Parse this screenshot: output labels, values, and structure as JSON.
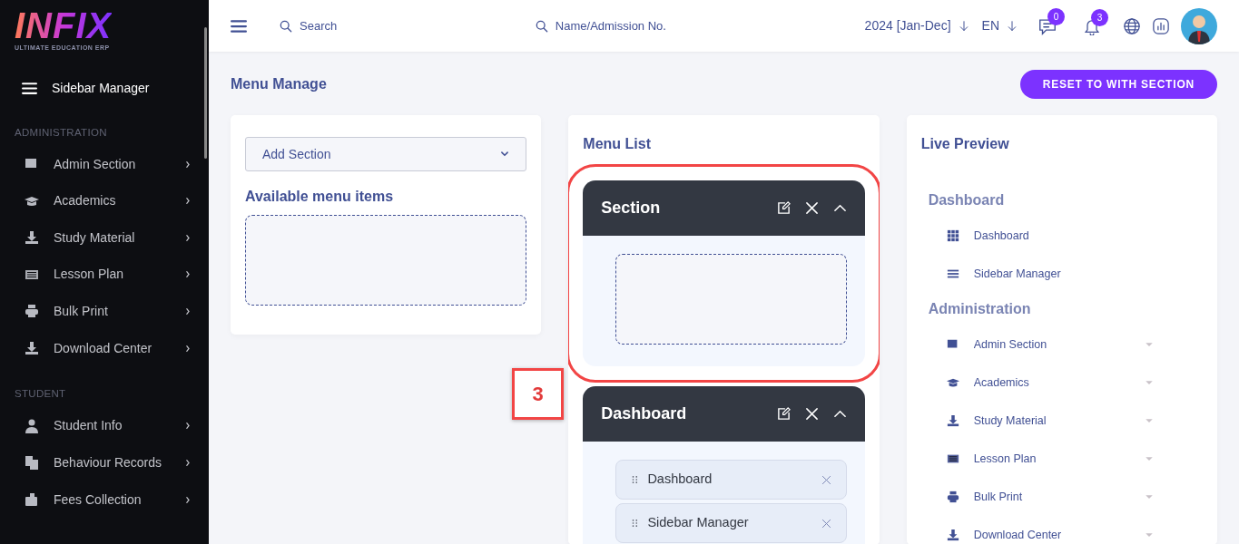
{
  "brand": {
    "logo": "INFIX",
    "tagline": "ULTIMATE EDUCATION ERP"
  },
  "sidebar": {
    "title": "Sidebar Manager",
    "groups": [
      {
        "heading": "ADMINISTRATION",
        "items": [
          {
            "label": "Admin Section"
          },
          {
            "label": "Academics"
          },
          {
            "label": "Study Material"
          },
          {
            "label": "Lesson Plan"
          },
          {
            "label": "Bulk Print"
          },
          {
            "label": "Download Center"
          }
        ]
      },
      {
        "heading": "STUDENT",
        "items": [
          {
            "label": "Student Info"
          },
          {
            "label": "Behaviour Records"
          },
          {
            "label": "Fees Collection"
          }
        ]
      }
    ]
  },
  "topbar": {
    "search": "Search",
    "admission_search": "Name/Admission No.",
    "year": "2024 [Jan-Dec]",
    "language": "EN",
    "messages_count": "0",
    "notifications_count": "3"
  },
  "page": {
    "title": "Menu Manage",
    "reset_button": "RESET TO WITH SECTION"
  },
  "available": {
    "select": "Add Section",
    "heading": "Available menu items"
  },
  "menu_list": {
    "title": "Menu List",
    "sections": [
      {
        "title": "Section",
        "highlighted": true
      },
      {
        "title": "Dashboard",
        "highlighted": false,
        "items": [
          "Dashboard",
          "Sidebar Manager"
        ]
      }
    ]
  },
  "annotation": "3",
  "live_preview": {
    "title": "Live Preview",
    "groups": [
      {
        "heading": "Dashboard",
        "items": [
          {
            "label": "Dashboard",
            "has_submenu": false
          },
          {
            "label": "Sidebar Manager",
            "has_submenu": false
          }
        ]
      },
      {
        "heading": "Administration",
        "items": [
          {
            "label": "Admin Section",
            "has_submenu": true
          },
          {
            "label": "Academics",
            "has_submenu": true
          },
          {
            "label": "Study Material",
            "has_submenu": true
          },
          {
            "label": "Lesson Plan",
            "has_submenu": true
          },
          {
            "label": "Bulk Print",
            "has_submenu": true
          },
          {
            "label": "Download Center",
            "has_submenu": true
          }
        ]
      }
    ]
  }
}
